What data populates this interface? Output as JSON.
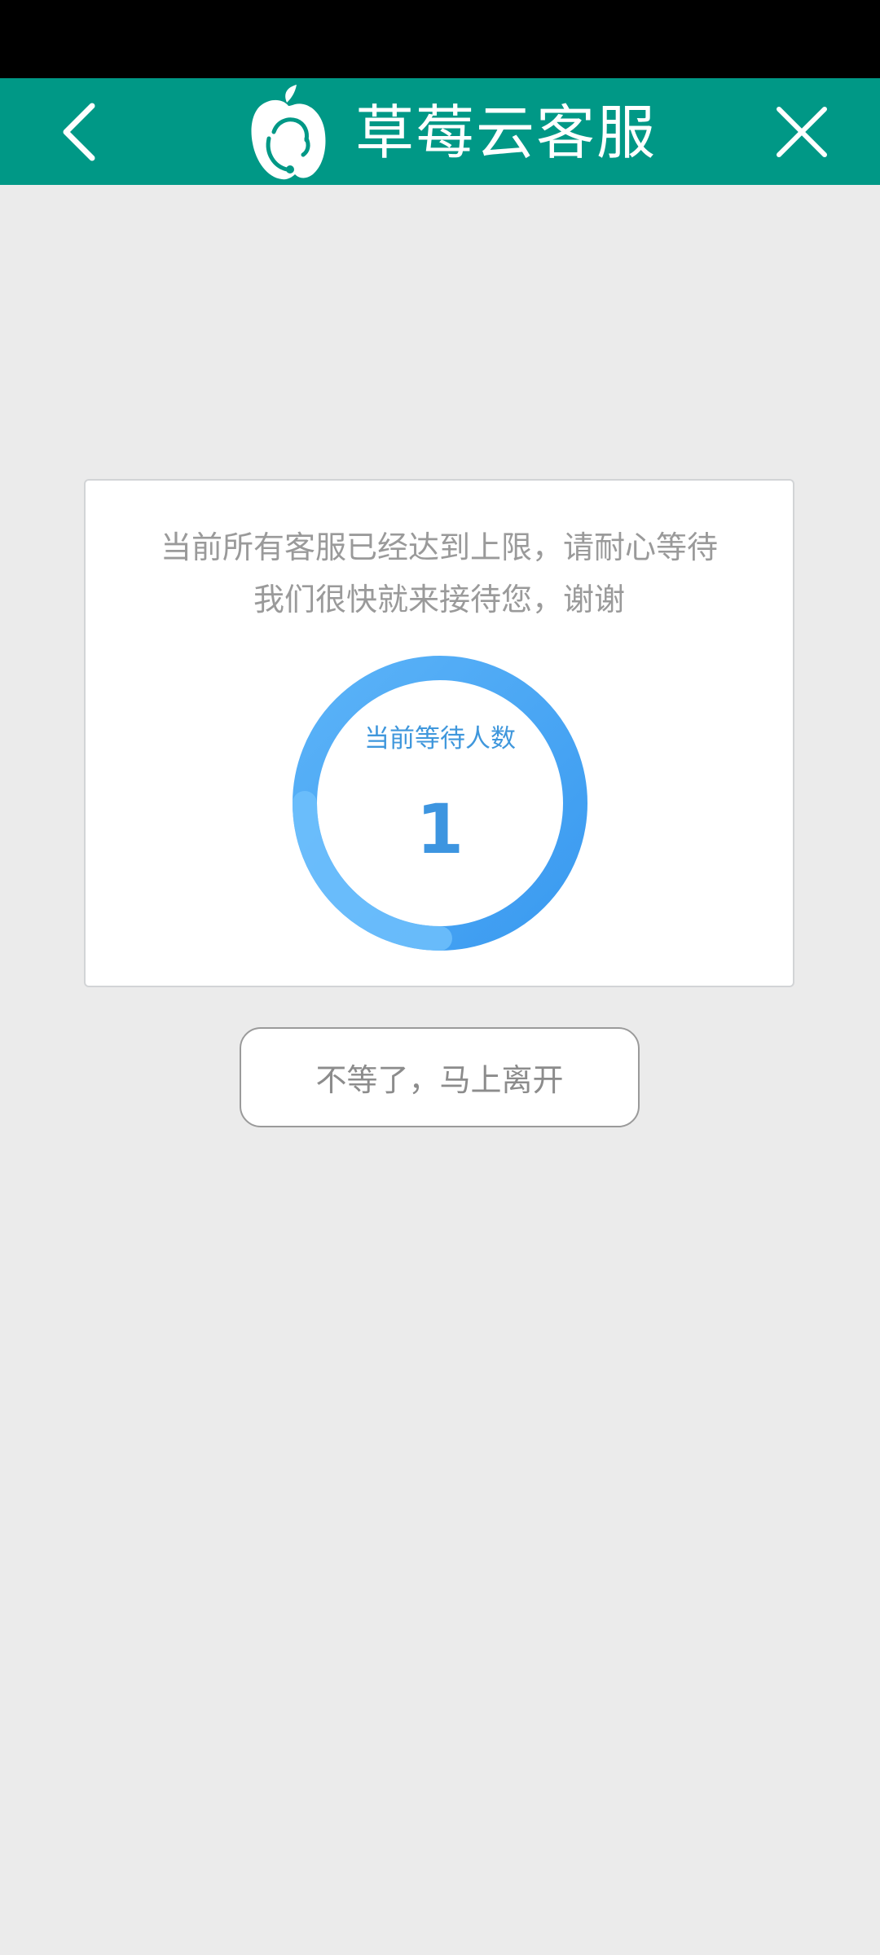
{
  "header": {
    "title": "草莓云客服",
    "back_icon": "chevron-left-icon",
    "close_icon": "close-icon",
    "logo_icon": "strawberry-agent-logo-icon",
    "background_color": "#009886"
  },
  "queue": {
    "notice_line1": "当前所有客服已经达到上限，请耐心等待",
    "notice_line2": "我们很快就来接待您，谢谢",
    "ring_label": "当前等待人数",
    "waiting_count": "1",
    "ring_color": "#4aa8f4"
  },
  "actions": {
    "leave_label": "不等了，马上离开"
  }
}
